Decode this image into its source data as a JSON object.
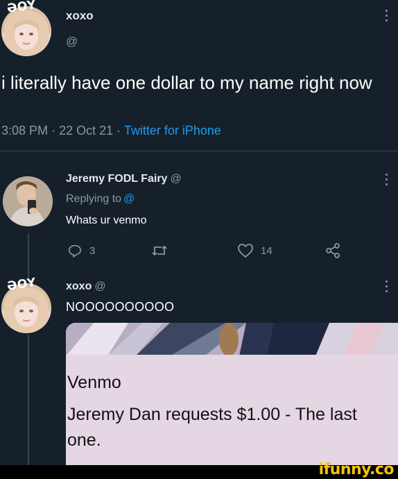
{
  "main_tweet": {
    "avatar_badge": "ƏOY",
    "author_name": "xoxo",
    "handle": "@",
    "text": "i literally have one dollar to my name right now",
    "time": "3:08 PM",
    "date": "22 Oct 21",
    "separator": "·",
    "source": "Twitter for iPhone"
  },
  "reply_1": {
    "author_name": "Jeremy FODL Fairy",
    "handle": "@",
    "replying_label": "Replying to",
    "replying_handle": "@",
    "text": "Whats ur venmo",
    "actions": {
      "reply_count": "3",
      "retweet_count": "",
      "like_count": "14"
    }
  },
  "reply_2": {
    "avatar_badge": "ƏOY",
    "author_name": "xoxo",
    "handle": "@",
    "text": "NOOOOOOOOOO",
    "embed": {
      "title": "Venmo",
      "body": "Jeremy Dan requests $1.00 - The last one."
    }
  },
  "watermark": "ifunny.co",
  "colors": {
    "background": "#15202b",
    "accent": "#1d9bf0",
    "secondary_text": "#8b98a5",
    "watermark": "#f5c400"
  },
  "icons": [
    "more-icon",
    "reply-icon",
    "retweet-icon",
    "like-icon",
    "share-icon"
  ]
}
